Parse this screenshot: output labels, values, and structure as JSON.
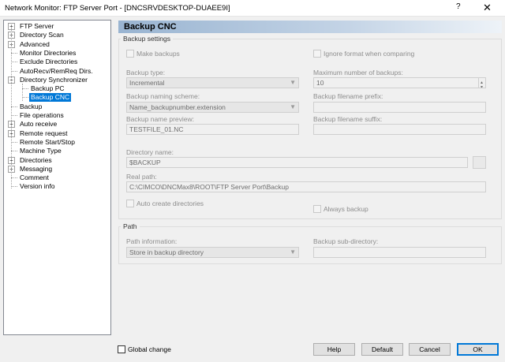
{
  "window": {
    "title": "Network Monitor: FTP Server Port - [DNCSRVDESKTOP-DUAEE9I]",
    "help_glyph": "?",
    "close_glyph": "✕"
  },
  "tree": {
    "items": [
      {
        "label": "FTP Server",
        "expander": "+"
      },
      {
        "label": "Directory Scan",
        "expander": "+"
      },
      {
        "label": "Advanced",
        "expander": "+"
      },
      {
        "label": "Monitor Directories",
        "expander": ""
      },
      {
        "label": "Exclude Directories",
        "expander": ""
      },
      {
        "label": "AutoRecv/RemReq Dirs.",
        "expander": ""
      },
      {
        "label": "Directory Synchronizer",
        "expander": "−"
      },
      {
        "label": "Backup PC",
        "expander": ""
      },
      {
        "label": "Backup CNC",
        "expander": ""
      },
      {
        "label": "Backup",
        "expander": ""
      },
      {
        "label": "File operations",
        "expander": ""
      },
      {
        "label": "Auto receive",
        "expander": "+"
      },
      {
        "label": "Remote request",
        "expander": "+"
      },
      {
        "label": "Remote Start/Stop",
        "expander": ""
      },
      {
        "label": "Machine Type",
        "expander": ""
      },
      {
        "label": "Directories",
        "expander": "+"
      },
      {
        "label": "Messaging",
        "expander": "+"
      },
      {
        "label": "Comment",
        "expander": ""
      },
      {
        "label": "Version info",
        "expander": ""
      }
    ],
    "selected": "Backup CNC"
  },
  "panel": {
    "title": "Backup CNC"
  },
  "backup_settings": {
    "group_title": "Backup settings",
    "make_backups": "Make backups",
    "ignore_format": "Ignore format when comparing",
    "backup_type_label": "Backup type:",
    "backup_type_value": "Incremental",
    "max_backups_label": "Maximum number of backups:",
    "max_backups_value": "10",
    "naming_scheme_label": "Backup naming scheme:",
    "naming_scheme_value": "Name_backupnumber.extension",
    "filename_prefix_label": "Backup filename prefix:",
    "filename_prefix_value": "",
    "name_preview_label": "Backup name preview:",
    "name_preview_value": "TESTFILE_01.NC",
    "filename_suffix_label": "Backup filename suffix:",
    "filename_suffix_value": "",
    "directory_name_label": "Directory name:",
    "directory_name_value": "$BACKUP",
    "real_path_label": "Real path:",
    "real_path_value": "C:\\CIMCO\\DNCMax8\\ROOT\\FTP Server Port\\Backup",
    "auto_create_dirs": "Auto create directories",
    "always_backup": "Always backup"
  },
  "path": {
    "group_title": "Path",
    "path_info_label": "Path information:",
    "path_info_value": "Store in backup directory",
    "sub_directory_label": "Backup sub-directory:",
    "sub_directory_value": ""
  },
  "footer": {
    "global_change": "Global change",
    "help": "Help",
    "default": "Default",
    "cancel": "Cancel",
    "ok": "OK"
  },
  "colors": {
    "selection": "#0078d7",
    "header_gradient_start": "#99b4d1",
    "disabled_text": "#8d8d8d"
  }
}
